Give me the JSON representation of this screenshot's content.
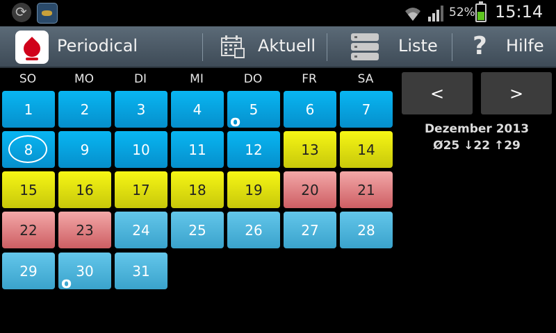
{
  "status_bar": {
    "battery_percent": "52%",
    "battery_level": 0.52,
    "time": "15:14"
  },
  "action_bar": {
    "app_title": "Periodical",
    "aktuell_label": "Aktuell",
    "liste_label": "Liste",
    "hilfe_label": "Hilfe",
    "hilfe_glyph": "?"
  },
  "calendar": {
    "weekdays": [
      "SO",
      "MO",
      "DI",
      "MI",
      "DO",
      "FR",
      "SA"
    ],
    "cells": [
      {
        "day": "1",
        "type": "blue"
      },
      {
        "day": "2",
        "type": "blue"
      },
      {
        "day": "3",
        "type": "blue"
      },
      {
        "day": "4",
        "type": "blue"
      },
      {
        "day": "5",
        "type": "blue",
        "marker": "o"
      },
      {
        "day": "6",
        "type": "blue"
      },
      {
        "day": "7",
        "type": "blue"
      },
      {
        "day": "8",
        "type": "blue",
        "today": true
      },
      {
        "day": "9",
        "type": "blue"
      },
      {
        "day": "10",
        "type": "blue"
      },
      {
        "day": "11",
        "type": "blue"
      },
      {
        "day": "12",
        "type": "blue"
      },
      {
        "day": "13",
        "type": "yellow"
      },
      {
        "day": "14",
        "type": "yellow"
      },
      {
        "day": "15",
        "type": "yellow"
      },
      {
        "day": "16",
        "type": "yellow"
      },
      {
        "day": "17",
        "type": "yellow"
      },
      {
        "day": "18",
        "type": "yellow"
      },
      {
        "day": "19",
        "type": "yellow"
      },
      {
        "day": "20",
        "type": "pink"
      },
      {
        "day": "21",
        "type": "pink"
      },
      {
        "day": "22",
        "type": "pink"
      },
      {
        "day": "23",
        "type": "pink"
      },
      {
        "day": "24",
        "type": "lightblue"
      },
      {
        "day": "25",
        "type": "lightblue"
      },
      {
        "day": "26",
        "type": "lightblue"
      },
      {
        "day": "27",
        "type": "lightblue"
      },
      {
        "day": "28",
        "type": "lightblue"
      },
      {
        "day": "29",
        "type": "lightblue"
      },
      {
        "day": "30",
        "type": "lightblue",
        "marker": "o"
      },
      {
        "day": "31",
        "type": "lightblue"
      }
    ]
  },
  "panel": {
    "prev_label": "<",
    "next_label": ">",
    "month_title": "Dezember 2013",
    "stats": "Ø25 ↓22 ↑29"
  },
  "colors": {
    "blue": "#08b6f2",
    "light_blue": "#4bb6dd",
    "yellow": "#f2f213",
    "pink": "#e48a8e"
  },
  "icons": {
    "sync": "sync-icon",
    "app_notification": "notification-app-icon",
    "wifi": "wifi-icon",
    "signal": "signal-icon",
    "battery": "battery-icon",
    "app_logo": "blood-drop-logo-icon",
    "aktuell": "calendar-icon",
    "liste": "list-icon",
    "hilfe": "help-icon"
  }
}
